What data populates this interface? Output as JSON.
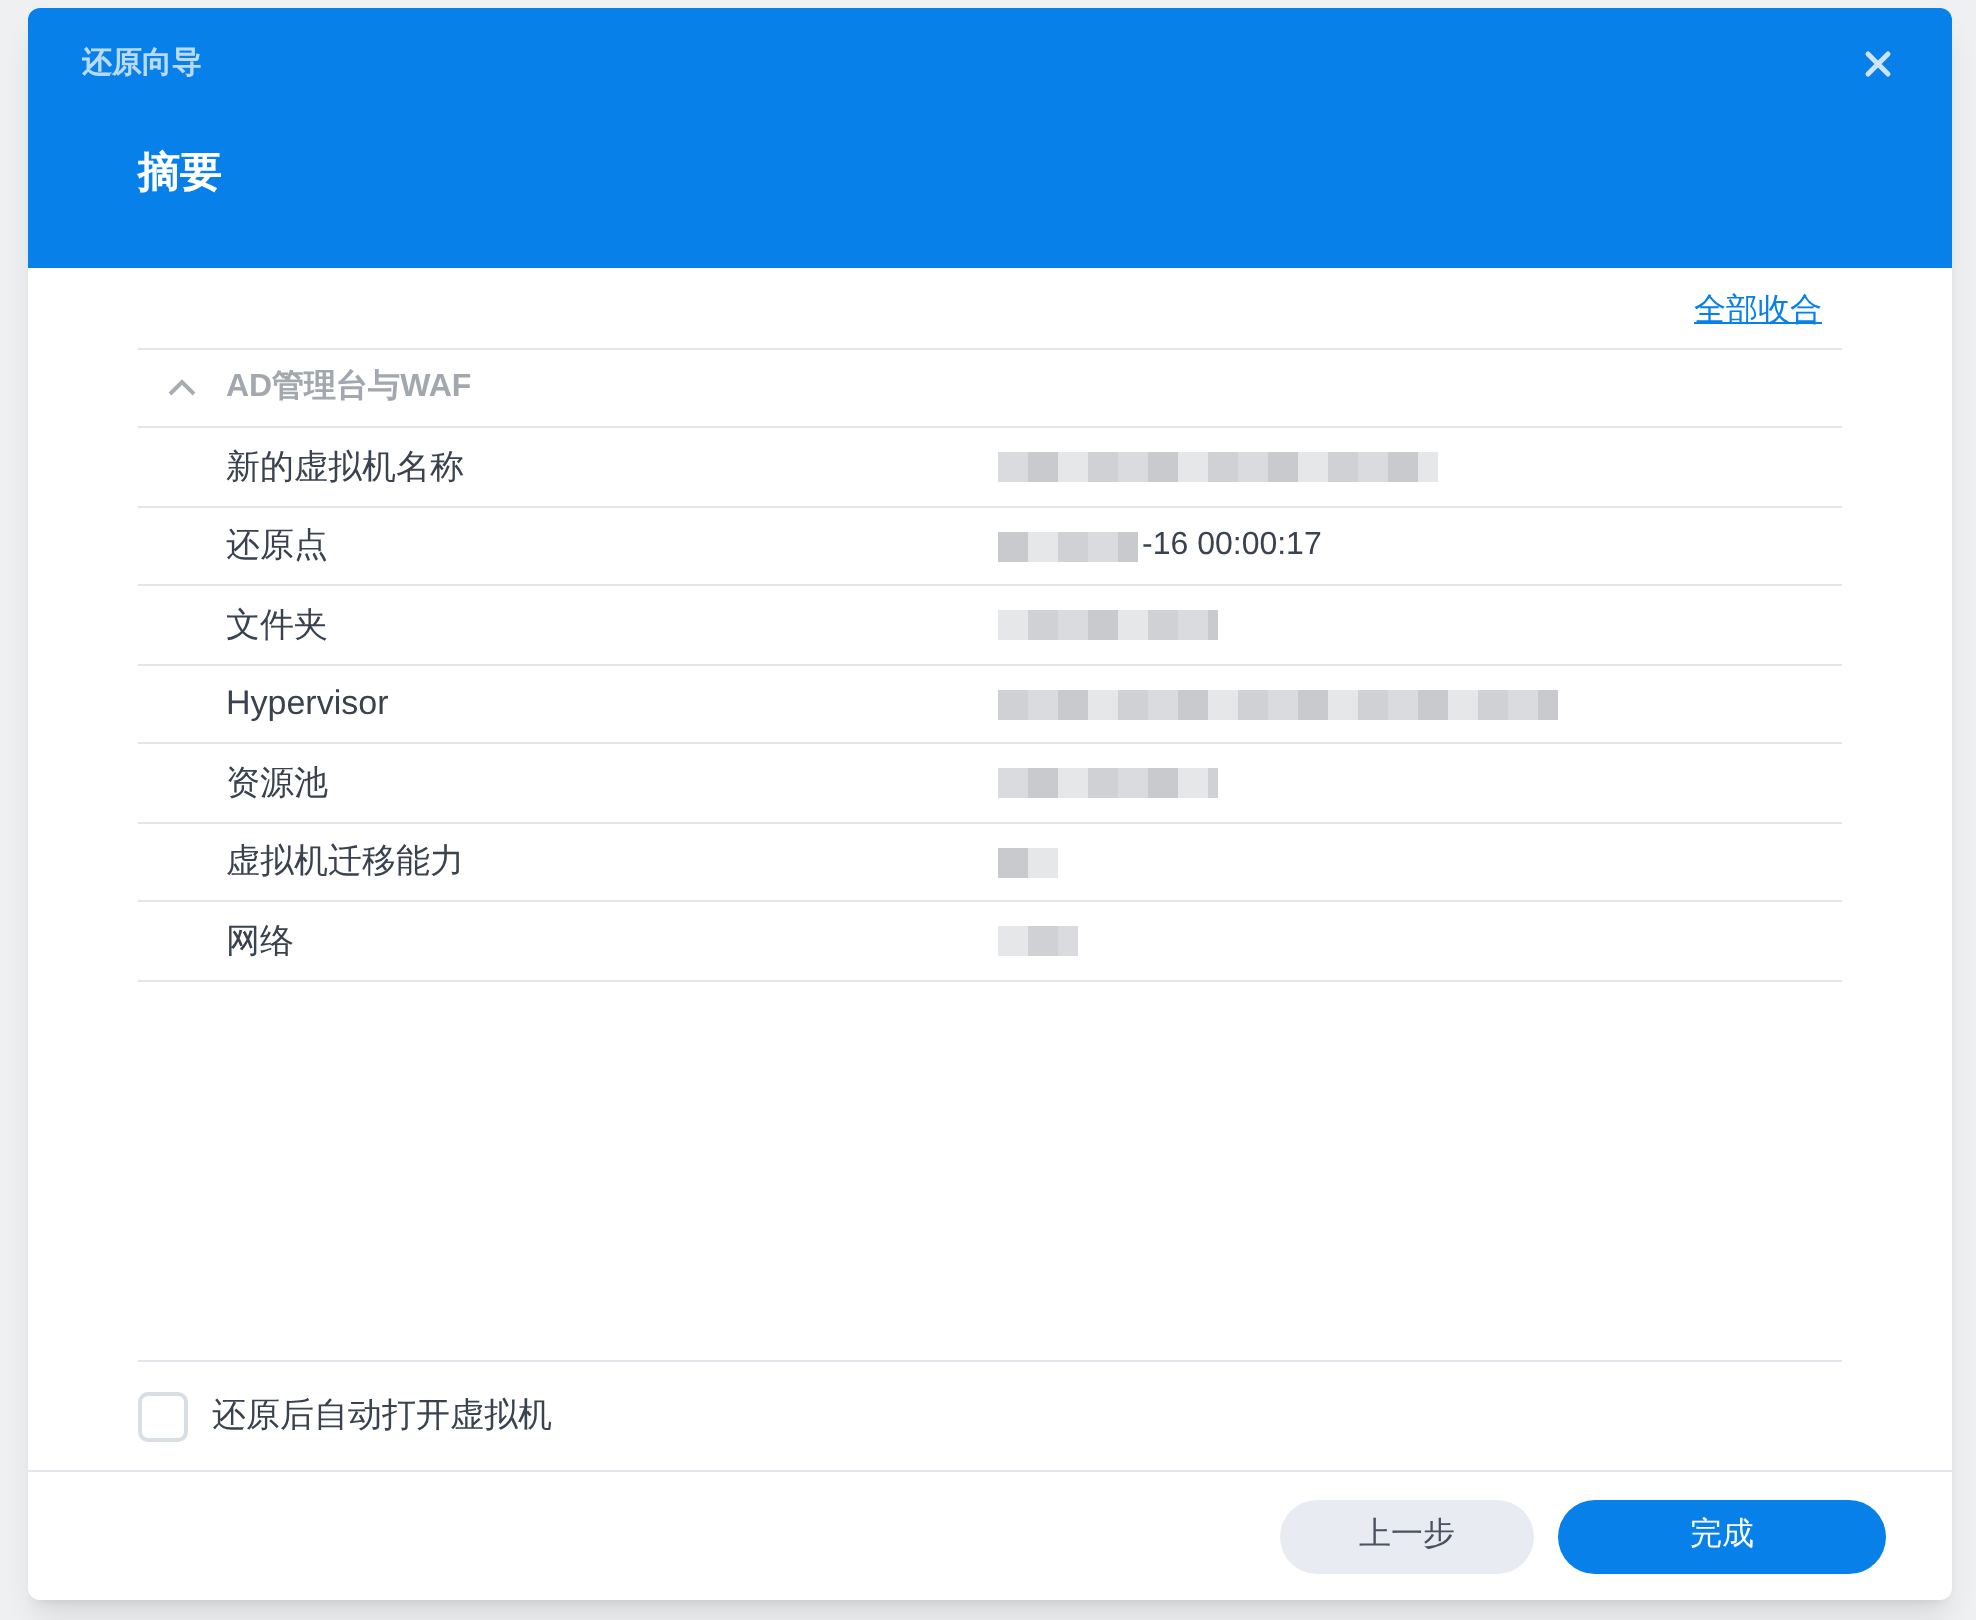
{
  "window": {
    "title": "还原向导"
  },
  "header": {
    "heading": "摘要"
  },
  "collapse_all_link": "全部收合",
  "section": {
    "title": "AD管理台与WAF",
    "expanded": true,
    "rows": [
      {
        "label": "新的虚拟机名称",
        "redacted": true
      },
      {
        "label": "还原点",
        "redacted": true,
        "value": "-16 00:00:17"
      },
      {
        "label": "文件夹",
        "redacted": true
      },
      {
        "label": "Hypervisor",
        "redacted": true
      },
      {
        "label": "资源池",
        "redacted": true
      },
      {
        "label": "虚拟机迁移能力",
        "redacted": true
      },
      {
        "label": "网络",
        "redacted": true
      }
    ]
  },
  "auto_power_on": {
    "label": "还原后自动打开虚拟机",
    "checked": false
  },
  "buttons": [
    {
      "label": "上一步",
      "kind": "secondary"
    },
    {
      "label": "完成",
      "kind": "primary"
    }
  ]
}
